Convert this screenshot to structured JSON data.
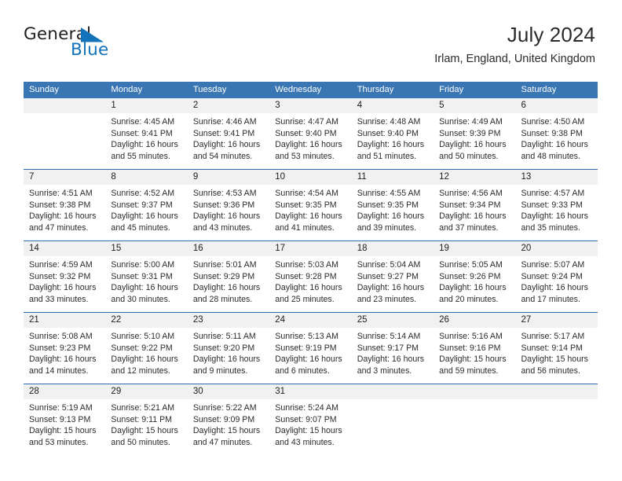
{
  "brand": {
    "word_one": "General",
    "word_two": "Blue",
    "mark_icon": "triangle-flag-icon",
    "accent_color": "#1273ba"
  },
  "header": {
    "title": "July 2024",
    "location": "Irlam, England, United Kingdom"
  },
  "calendar": {
    "header_bg": "#3a76b4",
    "date_band_bg": "#f1f1f1",
    "separator_color": "#2f6cab",
    "weekday_headers": [
      "Sunday",
      "Monday",
      "Tuesday",
      "Wednesday",
      "Thursday",
      "Friday",
      "Saturday"
    ],
    "weeks": [
      {
        "dates": [
          "",
          "1",
          "2",
          "3",
          "4",
          "5",
          "6"
        ],
        "cells": [
          {
            "lines": []
          },
          {
            "lines": [
              "Sunrise: 4:45 AM",
              "Sunset: 9:41 PM",
              "Daylight: 16 hours",
              "and 55 minutes."
            ]
          },
          {
            "lines": [
              "Sunrise: 4:46 AM",
              "Sunset: 9:41 PM",
              "Daylight: 16 hours",
              "and 54 minutes."
            ]
          },
          {
            "lines": [
              "Sunrise: 4:47 AM",
              "Sunset: 9:40 PM",
              "Daylight: 16 hours",
              "and 53 minutes."
            ]
          },
          {
            "lines": [
              "Sunrise: 4:48 AM",
              "Sunset: 9:40 PM",
              "Daylight: 16 hours",
              "and 51 minutes."
            ]
          },
          {
            "lines": [
              "Sunrise: 4:49 AM",
              "Sunset: 9:39 PM",
              "Daylight: 16 hours",
              "and 50 minutes."
            ]
          },
          {
            "lines": [
              "Sunrise: 4:50 AM",
              "Sunset: 9:38 PM",
              "Daylight: 16 hours",
              "and 48 minutes."
            ]
          }
        ]
      },
      {
        "dates": [
          "7",
          "8",
          "9",
          "10",
          "11",
          "12",
          "13"
        ],
        "cells": [
          {
            "lines": [
              "Sunrise: 4:51 AM",
              "Sunset: 9:38 PM",
              "Daylight: 16 hours",
              "and 47 minutes."
            ]
          },
          {
            "lines": [
              "Sunrise: 4:52 AM",
              "Sunset: 9:37 PM",
              "Daylight: 16 hours",
              "and 45 minutes."
            ]
          },
          {
            "lines": [
              "Sunrise: 4:53 AM",
              "Sunset: 9:36 PM",
              "Daylight: 16 hours",
              "and 43 minutes."
            ]
          },
          {
            "lines": [
              "Sunrise: 4:54 AM",
              "Sunset: 9:35 PM",
              "Daylight: 16 hours",
              "and 41 minutes."
            ]
          },
          {
            "lines": [
              "Sunrise: 4:55 AM",
              "Sunset: 9:35 PM",
              "Daylight: 16 hours",
              "and 39 minutes."
            ]
          },
          {
            "lines": [
              "Sunrise: 4:56 AM",
              "Sunset: 9:34 PM",
              "Daylight: 16 hours",
              "and 37 minutes."
            ]
          },
          {
            "lines": [
              "Sunrise: 4:57 AM",
              "Sunset: 9:33 PM",
              "Daylight: 16 hours",
              "and 35 minutes."
            ]
          }
        ]
      },
      {
        "dates": [
          "14",
          "15",
          "16",
          "17",
          "18",
          "19",
          "20"
        ],
        "cells": [
          {
            "lines": [
              "Sunrise: 4:59 AM",
              "Sunset: 9:32 PM",
              "Daylight: 16 hours",
              "and 33 minutes."
            ]
          },
          {
            "lines": [
              "Sunrise: 5:00 AM",
              "Sunset: 9:31 PM",
              "Daylight: 16 hours",
              "and 30 minutes."
            ]
          },
          {
            "lines": [
              "Sunrise: 5:01 AM",
              "Sunset: 9:29 PM",
              "Daylight: 16 hours",
              "and 28 minutes."
            ]
          },
          {
            "lines": [
              "Sunrise: 5:03 AM",
              "Sunset: 9:28 PM",
              "Daylight: 16 hours",
              "and 25 minutes."
            ]
          },
          {
            "lines": [
              "Sunrise: 5:04 AM",
              "Sunset: 9:27 PM",
              "Daylight: 16 hours",
              "and 23 minutes."
            ]
          },
          {
            "lines": [
              "Sunrise: 5:05 AM",
              "Sunset: 9:26 PM",
              "Daylight: 16 hours",
              "and 20 minutes."
            ]
          },
          {
            "lines": [
              "Sunrise: 5:07 AM",
              "Sunset: 9:24 PM",
              "Daylight: 16 hours",
              "and 17 minutes."
            ]
          }
        ]
      },
      {
        "dates": [
          "21",
          "22",
          "23",
          "24",
          "25",
          "26",
          "27"
        ],
        "cells": [
          {
            "lines": [
              "Sunrise: 5:08 AM",
              "Sunset: 9:23 PM",
              "Daylight: 16 hours",
              "and 14 minutes."
            ]
          },
          {
            "lines": [
              "Sunrise: 5:10 AM",
              "Sunset: 9:22 PM",
              "Daylight: 16 hours",
              "and 12 minutes."
            ]
          },
          {
            "lines": [
              "Sunrise: 5:11 AM",
              "Sunset: 9:20 PM",
              "Daylight: 16 hours",
              "and 9 minutes."
            ]
          },
          {
            "lines": [
              "Sunrise: 5:13 AM",
              "Sunset: 9:19 PM",
              "Daylight: 16 hours",
              "and 6 minutes."
            ]
          },
          {
            "lines": [
              "Sunrise: 5:14 AM",
              "Sunset: 9:17 PM",
              "Daylight: 16 hours",
              "and 3 minutes."
            ]
          },
          {
            "lines": [
              "Sunrise: 5:16 AM",
              "Sunset: 9:16 PM",
              "Daylight: 15 hours",
              "and 59 minutes."
            ]
          },
          {
            "lines": [
              "Sunrise: 5:17 AM",
              "Sunset: 9:14 PM",
              "Daylight: 15 hours",
              "and 56 minutes."
            ]
          }
        ]
      },
      {
        "dates": [
          "28",
          "29",
          "30",
          "31",
          "",
          "",
          ""
        ],
        "cells": [
          {
            "lines": [
              "Sunrise: 5:19 AM",
              "Sunset: 9:13 PM",
              "Daylight: 15 hours",
              "and 53 minutes."
            ]
          },
          {
            "lines": [
              "Sunrise: 5:21 AM",
              "Sunset: 9:11 PM",
              "Daylight: 15 hours",
              "and 50 minutes."
            ]
          },
          {
            "lines": [
              "Sunrise: 5:22 AM",
              "Sunset: 9:09 PM",
              "Daylight: 15 hours",
              "and 47 minutes."
            ]
          },
          {
            "lines": [
              "Sunrise: 5:24 AM",
              "Sunset: 9:07 PM",
              "Daylight: 15 hours",
              "and 43 minutes."
            ]
          },
          {
            "lines": []
          },
          {
            "lines": []
          },
          {
            "lines": []
          }
        ]
      }
    ]
  }
}
